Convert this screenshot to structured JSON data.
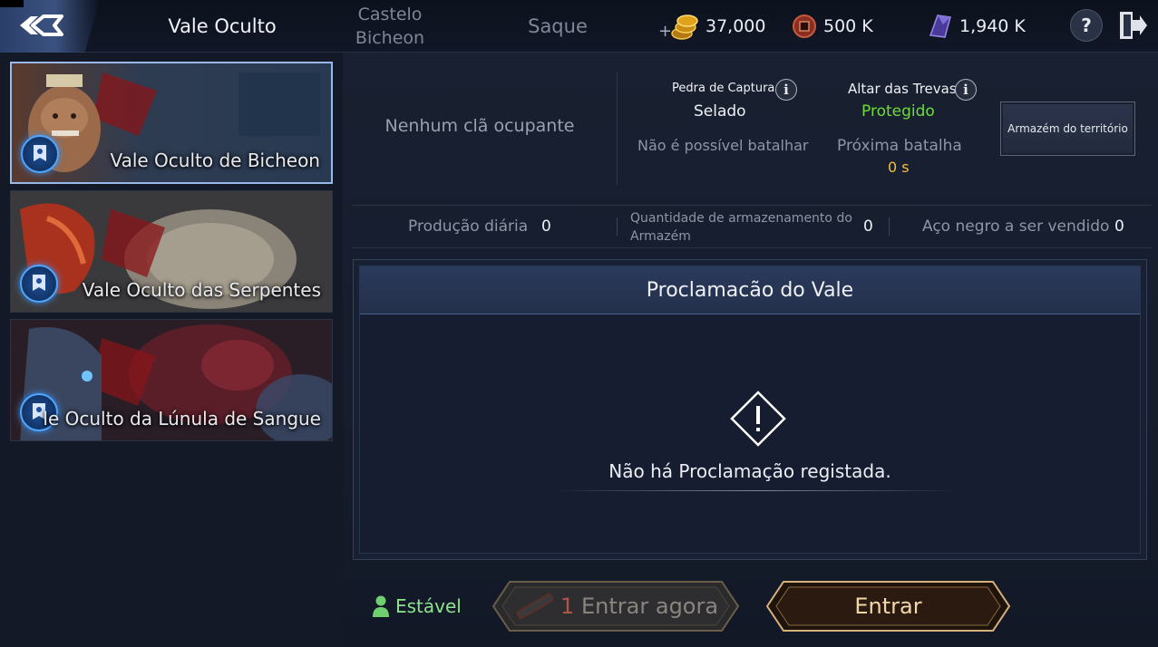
{
  "header": {
    "tabs": [
      {
        "label": "Vale Oculto",
        "active": true
      },
      {
        "label_line1": "Castelo",
        "label_line2": "Bicheon",
        "active": false
      },
      {
        "label": "Saque",
        "active": false
      }
    ],
    "currencies": {
      "gold": "37,000",
      "coin": "500 K",
      "crystal": "1,940 K"
    },
    "help_label": "?"
  },
  "valleys": [
    {
      "name": "Vale Oculto de Bicheon",
      "selected": true
    },
    {
      "name": "Vale Oculto das Serpentes",
      "selected": false
    },
    {
      "name": "le Oculto da Lúnula de Sangue",
      "selected": false
    }
  ],
  "info": {
    "occupant": "Nenhum clã ocupante",
    "capture_stone_label": "Pedra de Captura",
    "capture_stone_value": "Selado",
    "altar_label": "Altar das Trevas",
    "altar_value": "Protegido",
    "battle_status": "Não é possível batalhar",
    "next_battle_label": "Próxima batalha",
    "next_battle_value": "0 s",
    "warehouse_button": "Armazém do território"
  },
  "production": {
    "daily_label": "Produção diária",
    "daily_value": "0",
    "storage_label_line1": "Quantidade de armazenamento do",
    "storage_label_line2": "Armazém",
    "storage_value": "0",
    "black_steel_label": "Aço negro a ser vendido",
    "black_steel_value": "0"
  },
  "proclamation": {
    "title": "Proclamacão do Vale",
    "empty_message": "Não há Proclamação registada."
  },
  "footer": {
    "server_status": "Estável",
    "enter_now_count": "1",
    "enter_now_label": "Entrar agora",
    "enter_label": "Entrar"
  },
  "colors": {
    "protected_green": "#6fdc3c",
    "timer_yellow": "#f0c040",
    "stable_green": "#8fe38f"
  }
}
